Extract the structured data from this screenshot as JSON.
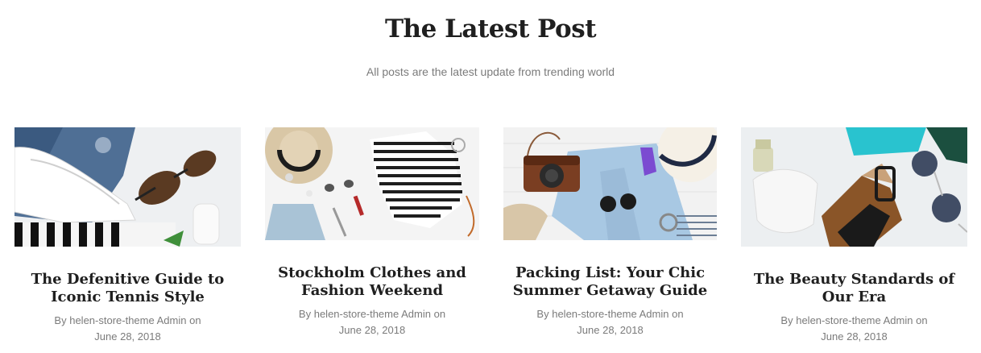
{
  "section": {
    "title": "The Latest Post",
    "subtitle": "All posts are the latest update from trending world"
  },
  "posts": [
    {
      "title": "The Defenitive Guide to Iconic Tennis Style",
      "by": "By",
      "author": "helen-store-theme Admin",
      "on": "on",
      "date": "June 28, 2018",
      "image": "flatlay-sneakers-sunglasses"
    },
    {
      "title": "Stockholm Clothes and Fashion Weekend",
      "by": "By",
      "author": "helen-store-theme Admin",
      "on": "on",
      "date": "June 28, 2018",
      "image": "flatlay-hat-striped-swimsuit"
    },
    {
      "title": "Packing List: Your Chic Summer Getaway Guide",
      "by": "By",
      "author": "helen-store-theme Admin",
      "on": "on",
      "date": "June 28, 2018",
      "image": "flatlay-camera-denim-jacket"
    },
    {
      "title": "The Beauty Standards of Our Era",
      "by": "By",
      "author": "helen-store-theme Admin",
      "on": "on",
      "date": "June 28, 2018",
      "image": "flatlay-sandals-sunglasses"
    }
  ]
}
